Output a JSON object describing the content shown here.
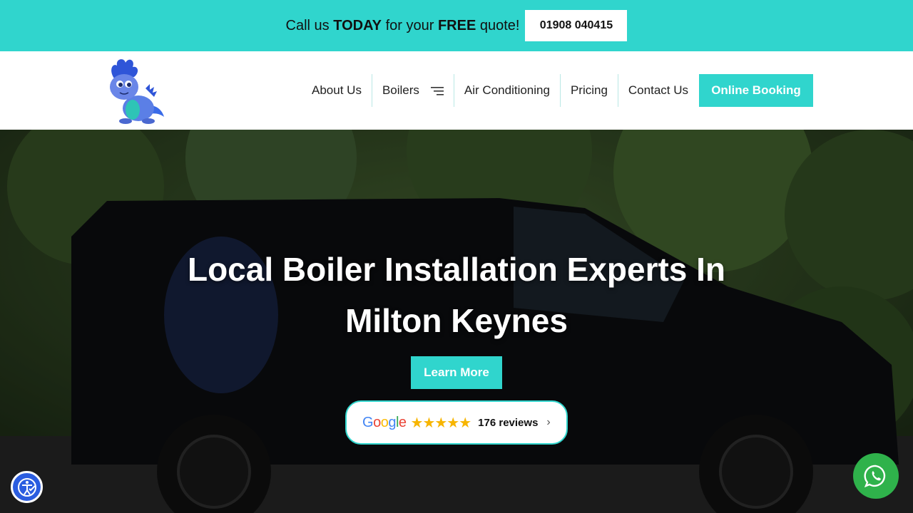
{
  "topbar": {
    "call_prefix": "Call us ",
    "call_today": "TODAY",
    "call_middle": " for your ",
    "call_free": "FREE",
    "call_suffix": " quote!",
    "phone": "01908 040415",
    "bg_color": "#30d5cd"
  },
  "header": {
    "logo_icon": "dragon-mascot-logo",
    "nav": [
      {
        "label": "About Us"
      },
      {
        "label": "Boilers",
        "icon": "hamburger-menu-icon"
      },
      {
        "label": "Air Conditioning"
      },
      {
        "label": "Pricing"
      },
      {
        "label": "Contact Us"
      }
    ],
    "booking_label": "Online Booking",
    "accent_color": "#30d5cd"
  },
  "hero": {
    "title_line1": "Local Boiler Installation Experts In",
    "title_line2": "Milton Keynes",
    "cta_label": "Learn More",
    "background": "black-van-photo",
    "reviews": {
      "brand": "Google",
      "stars": "★★★★★",
      "count_text": "176 reviews",
      "rating_stars": 5
    }
  },
  "floating": {
    "accessibility_icon": "accessibility-icon",
    "whatsapp_icon": "whatsapp-icon"
  }
}
